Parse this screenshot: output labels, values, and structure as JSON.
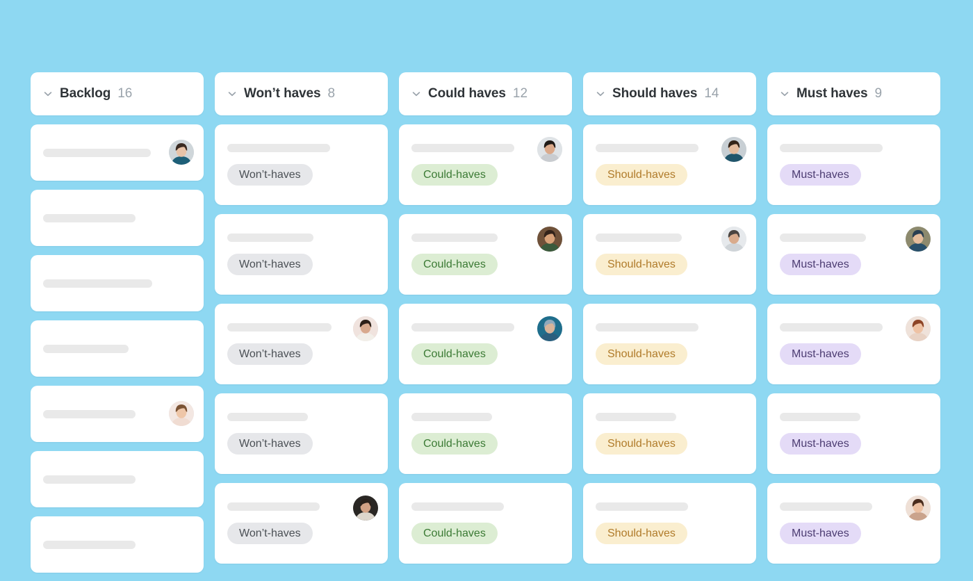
{
  "board": {
    "background_color": "#8ed8f2",
    "columns": [
      {
        "id": "backlog",
        "title": "Backlog",
        "count": "16",
        "collapse_icon": "chevron-down-icon",
        "card_style": "plain",
        "tag": null,
        "cards": [
          {
            "skeleton_width": 155,
            "avatar": "avatar-woman-dark-hair"
          },
          {
            "skeleton_width": 133,
            "avatar": null
          },
          {
            "skeleton_width": 157,
            "avatar": null
          },
          {
            "skeleton_width": 123,
            "avatar": null
          },
          {
            "skeleton_width": 133,
            "avatar": "avatar-woman-long-hair"
          },
          {
            "skeleton_width": 133,
            "avatar": null
          },
          {
            "skeleton_width": 133,
            "avatar": null
          }
        ]
      },
      {
        "id": "wont-haves",
        "title": "Won’t haves",
        "count": "8",
        "collapse_icon": "chevron-down-icon",
        "card_style": "tagged",
        "tag": {
          "label": "Won’t-haves",
          "background_color": "#e6e7ea",
          "text_color": "#4b5055"
        },
        "cards": [
          {
            "skeleton_width": 148,
            "avatar": null
          },
          {
            "skeleton_width": 124,
            "avatar": null
          },
          {
            "skeleton_width": 150,
            "avatar": "avatar-man-light-shirt"
          },
          {
            "skeleton_width": 116,
            "avatar": null
          },
          {
            "skeleton_width": 133,
            "avatar": "avatar-man-beard"
          }
        ]
      },
      {
        "id": "could-haves",
        "title": "Could haves",
        "count": "12",
        "collapse_icon": "chevron-down-icon",
        "card_style": "tagged",
        "tag": {
          "label": "Could-haves",
          "background_color": "#dcedd3",
          "text_color": "#3b7a34"
        },
        "cards": [
          {
            "skeleton_width": 148,
            "avatar": "avatar-man-cap"
          },
          {
            "skeleton_width": 124,
            "avatar": "avatar-woman-curly"
          },
          {
            "skeleton_width": 148,
            "avatar": "avatar-person-hood-blue"
          },
          {
            "skeleton_width": 116,
            "avatar": null
          },
          {
            "skeleton_width": 133,
            "avatar": null
          }
        ]
      },
      {
        "id": "should-haves",
        "title": "Should haves",
        "count": "14",
        "collapse_icon": "chevron-down-icon",
        "card_style": "tagged",
        "tag": {
          "label": "Should-haves",
          "background_color": "#faeecf",
          "text_color": "#b07b2a"
        },
        "cards": [
          {
            "skeleton_width": 148,
            "avatar": "avatar-woman-dark-hair-2"
          },
          {
            "skeleton_width": 124,
            "avatar": "avatar-man-glasses"
          },
          {
            "skeleton_width": 148,
            "avatar": null
          },
          {
            "skeleton_width": 116,
            "avatar": null
          },
          {
            "skeleton_width": 133,
            "avatar": null
          }
        ]
      },
      {
        "id": "must-haves",
        "title": "Must haves",
        "count": "9",
        "collapse_icon": "chevron-down-icon",
        "card_style": "tagged",
        "tag": {
          "label": "Must-haves",
          "background_color": "#e4dbf7",
          "text_color": "#4c3c72"
        },
        "cards": [
          {
            "skeleton_width": 148,
            "avatar": null
          },
          {
            "skeleton_width": 124,
            "avatar": "avatar-woman-hood-smile"
          },
          {
            "skeleton_width": 148,
            "avatar": "avatar-woman-redhead"
          },
          {
            "skeleton_width": 116,
            "avatar": null
          },
          {
            "skeleton_width": 133,
            "avatar": "avatar-woman-brunette"
          }
        ]
      }
    ]
  }
}
